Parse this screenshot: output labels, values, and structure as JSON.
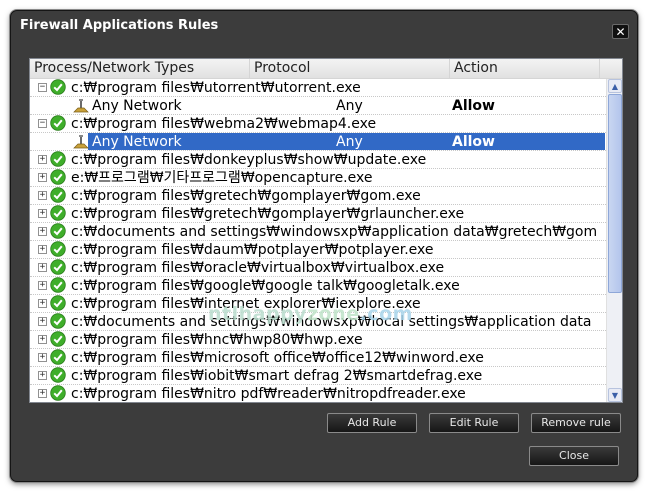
{
  "window": {
    "title": "Firewall Applications Rules",
    "close_glyph": "✕"
  },
  "grid": {
    "columns": [
      "Process/Network Types",
      "Protocol",
      "Action"
    ],
    "rows": [
      {
        "kind": "parent",
        "expander": "−",
        "text": "c:₩program files₩utorrent₩utorrent.exe"
      },
      {
        "kind": "sub",
        "name": "Any Network",
        "protocol": "Any",
        "action": "Allow",
        "selected": false
      },
      {
        "kind": "parent",
        "expander": "−",
        "text": "c:₩program files₩webma2₩webmap4.exe"
      },
      {
        "kind": "sub",
        "name": "Any Network",
        "protocol": "Any",
        "action": "Allow",
        "selected": true
      },
      {
        "kind": "parent",
        "expander": "+",
        "text": "c:₩program files₩donkeyplus₩show₩update.exe"
      },
      {
        "kind": "parent",
        "expander": "+",
        "text": "e:₩프로그램₩기타프로그램₩opencapture.exe"
      },
      {
        "kind": "parent",
        "expander": "+",
        "text": "c:₩program files₩gretech₩gomplayer₩gom.exe"
      },
      {
        "kind": "parent",
        "expander": "+",
        "text": "c:₩program files₩gretech₩gomplayer₩grlauncher.exe"
      },
      {
        "kind": "parent",
        "expander": "+",
        "text": "c:₩documents and settings₩windowsxp₩application data₩gretech₩gom"
      },
      {
        "kind": "parent",
        "expander": "+",
        "text": "c:₩program files₩daum₩potplayer₩potplayer.exe"
      },
      {
        "kind": "parent",
        "expander": "+",
        "text": "c:₩program files₩oracle₩virtualbox₩virtualbox.exe"
      },
      {
        "kind": "parent",
        "expander": "+",
        "text": "c:₩program files₩google₩google talk₩googletalk.exe"
      },
      {
        "kind": "parent",
        "expander": "+",
        "text": "c:₩program files₩internet explorer₩iexplore.exe"
      },
      {
        "kind": "parent",
        "expander": "+",
        "text": "c:₩documents and settings₩windowsxp₩local settings₩application data"
      },
      {
        "kind": "parent",
        "expander": "+",
        "text": "c:₩program files₩hnc₩hwp80₩hwp.exe"
      },
      {
        "kind": "parent",
        "expander": "+",
        "text": "c:₩program files₩microsoft office₩office12₩winword.exe"
      },
      {
        "kind": "parent",
        "expander": "+",
        "text": "c:₩program files₩iobit₩smart defrag 2₩smartdefrag.exe"
      },
      {
        "kind": "parent",
        "expander": "+",
        "text": "c:₩program files₩nitro pdf₩reader₩nitropdfreader.exe"
      }
    ],
    "scroll_up": "▲",
    "scroll_down": "▼"
  },
  "watermark": {
    "part1": "ntlhappy",
    "part2": "zone",
    "part3": ".com"
  },
  "buttons": {
    "add_rule": "Add Rule",
    "edit_rule": "Edit Rule",
    "remove_rule": "Remove rule",
    "close": "Close"
  },
  "colors": {
    "dialog_bg": "#3c3c3c",
    "selection": "#3169c6",
    "check_green": "#3fae2a"
  }
}
